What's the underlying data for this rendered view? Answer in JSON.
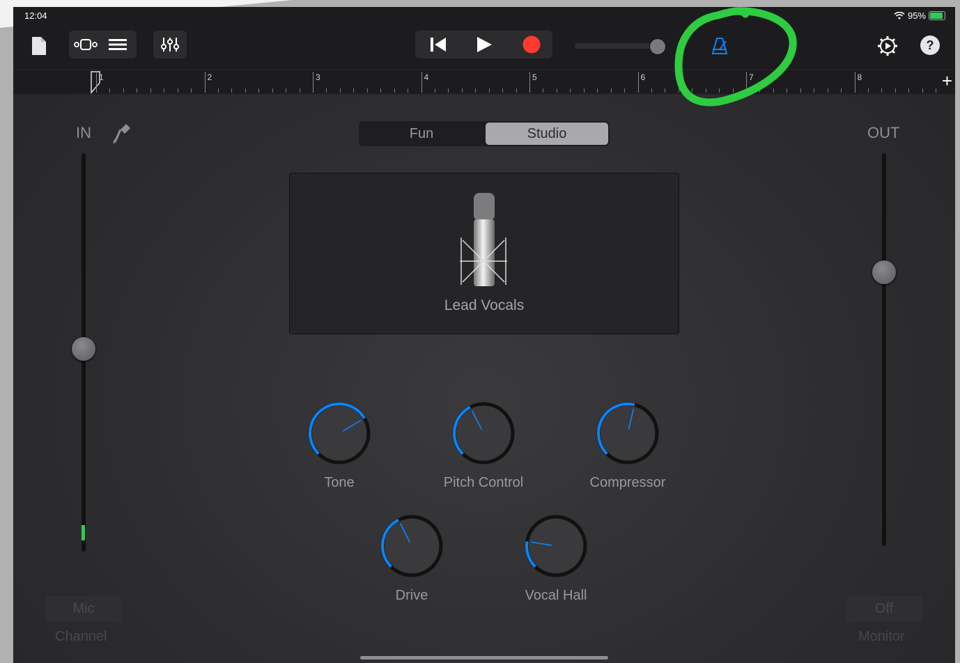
{
  "status": {
    "time": "12:04",
    "battery": "95%"
  },
  "toolbar": {
    "icons": [
      "document-icon",
      "tracks-view-icon",
      "list-view-icon",
      "mixer-controls-icon",
      "skip-back-icon",
      "play-icon",
      "record-icon",
      "metronome-icon",
      "settings-icon",
      "help-icon"
    ],
    "help_label": "?",
    "accent": "#0a84ff",
    "record_color": "#ff3b30"
  },
  "ruler": {
    "bars": [
      "1",
      "2",
      "3",
      "4",
      "5",
      "6",
      "7",
      "8"
    ],
    "add_label": "+"
  },
  "input": {
    "label": "IN",
    "level": 0.5
  },
  "output": {
    "label": "OUT",
    "level": 0.7
  },
  "mode": {
    "options": [
      "Fun",
      "Studio"
    ],
    "selected": "Studio"
  },
  "preset": {
    "name": "Lead Vocals"
  },
  "knobs": [
    {
      "label": "Tone",
      "value": 0.72
    },
    {
      "label": "Pitch Control",
      "value": 0.4
    },
    {
      "label": "Compressor",
      "value": 0.55
    },
    {
      "label": "Drive",
      "value": 0.4
    },
    {
      "label": "Vocal Hall",
      "value": 0.2
    }
  ],
  "channel": {
    "button": "Mic",
    "label": "Channel"
  },
  "monitor": {
    "button": "Off",
    "label": "Monitor"
  },
  "annotation_color": "#2ecc40"
}
